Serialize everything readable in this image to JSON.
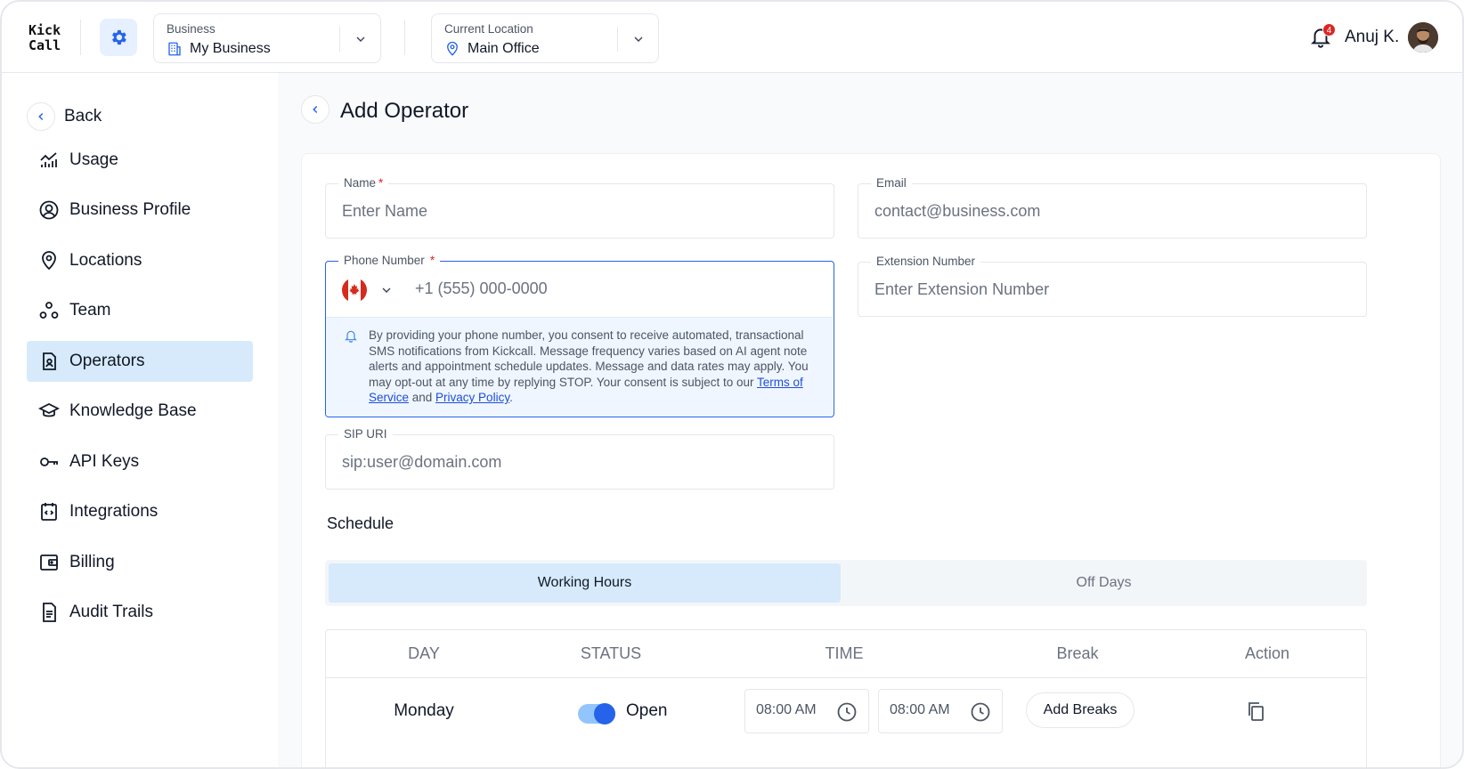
{
  "app": {
    "logo_line1": "Kick",
    "logo_line2": "Call"
  },
  "header": {
    "business": {
      "label": "Business",
      "value": "My Business"
    },
    "location": {
      "label": "Current Location",
      "value": "Main Office"
    },
    "notifications_count": "4",
    "user_name": "Anuj K."
  },
  "sidebar": {
    "back_label": "Back",
    "items": [
      {
        "label": "Usage",
        "icon": "chart-icon"
      },
      {
        "label": "Business Profile",
        "icon": "user-circle-icon"
      },
      {
        "label": "Locations",
        "icon": "map-pin-icon"
      },
      {
        "label": "Team",
        "icon": "team-icon"
      },
      {
        "label": "Operators",
        "icon": "operator-icon",
        "active": true
      },
      {
        "label": "Knowledge Base",
        "icon": "graduation-cap-icon"
      },
      {
        "label": "API Keys",
        "icon": "key-icon"
      },
      {
        "label": "Integrations",
        "icon": "code-icon"
      },
      {
        "label": "Billing",
        "icon": "wallet-icon"
      },
      {
        "label": "Audit Trails",
        "icon": "document-icon"
      }
    ]
  },
  "page": {
    "title": "Add Operator",
    "form": {
      "name": {
        "label": "Name",
        "placeholder": "Enter Name",
        "required": "*"
      },
      "email": {
        "label": "Email",
        "placeholder": "contact@business.com"
      },
      "phone": {
        "label": "Phone Number",
        "required": "*",
        "placeholder": "+1 (555) 000-0000",
        "consent_text": "By providing your phone number, you consent to receive automated, transactional SMS notifications from Kickcall. Message frequency varies based on AI agent note alerts and appointment schedule updates. Message and data rates may apply. You may opt-out at any time by replying STOP. Your consent is subject to our ",
        "terms_link": "Terms of Service",
        "and": " and ",
        "privacy_link": "Privacy Policy",
        "period": "."
      },
      "extension": {
        "label": "Extension  Number",
        "placeholder": "Enter Extension Number"
      },
      "sip": {
        "label": "SIP URI",
        "placeholder": "sip:user@domain.com"
      }
    },
    "schedule": {
      "title": "Schedule",
      "tabs": [
        "Working Hours",
        "Off Days"
      ],
      "columns": [
        "DAY",
        "STATUS",
        "TIME",
        "Break",
        "Action"
      ],
      "rows": [
        {
          "day": "Monday",
          "status": "Open",
          "start": "08:00 AM",
          "end": "08:00 AM",
          "break_button": "Add Breaks"
        }
      ]
    }
  },
  "colors": {
    "accent": "#2563eb",
    "active_bg": "#d6eafb",
    "required": "#dc2626"
  }
}
